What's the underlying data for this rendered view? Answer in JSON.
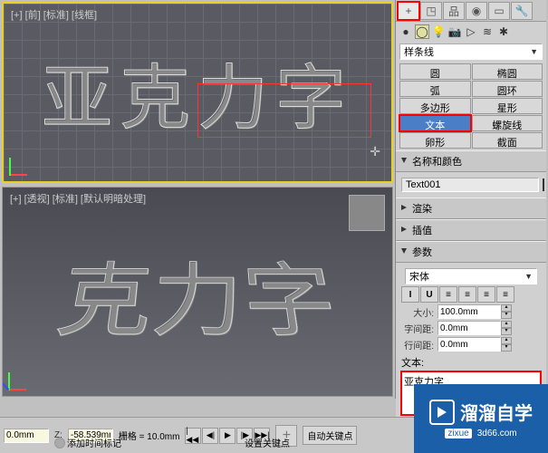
{
  "viewports": {
    "top_label": "[+] [前] [标准] [线框]",
    "bottom_label": "[+] [透视] [标准] [默认明暗处理]",
    "text3d": "亚克力字",
    "text3d_partial": "克力字"
  },
  "panel": {
    "spline_dropdown": "样条线",
    "shapes": [
      {
        "label": "圆",
        "sel": false
      },
      {
        "label": "椭圆",
        "sel": false
      },
      {
        "label": "弧",
        "sel": false
      },
      {
        "label": "圆环",
        "sel": false
      },
      {
        "label": "多边形",
        "sel": false
      },
      {
        "label": "星形",
        "sel": false
      },
      {
        "label": "文本",
        "sel": true
      },
      {
        "label": "螺旋线",
        "sel": false
      },
      {
        "label": "卵形",
        "sel": false
      },
      {
        "label": "截面",
        "sel": false
      }
    ],
    "rollouts": {
      "name_color": "名称和颜色",
      "object_name": "Text001",
      "render": "渲染",
      "interpolation": "插值",
      "params": "参数"
    },
    "font_dropdown": "宋体",
    "text_style": [
      "I",
      "U",
      "≡",
      "≡",
      "≡",
      "≡"
    ],
    "size_label": "大小:",
    "size_value": "100.0mm",
    "kerning_label": "字间距:",
    "kerning_value": "0.0mm",
    "leading_label": "行间距:",
    "leading_value": "0.0mm",
    "text_label": "文本:",
    "text_value": "亚克力字"
  },
  "timeline": {
    "frame": "0.0mm",
    "z_label": "Z:",
    "z_value": "-58.539mm",
    "grid_label": "栅格 = 10.0mm",
    "auto_key": "自动关键点",
    "add_time_marker": "添加时间标记",
    "set_keys": "设置关键点"
  },
  "watermark": {
    "title": "溜溜自学",
    "domain": "zixue",
    "url": "3d66.com"
  }
}
